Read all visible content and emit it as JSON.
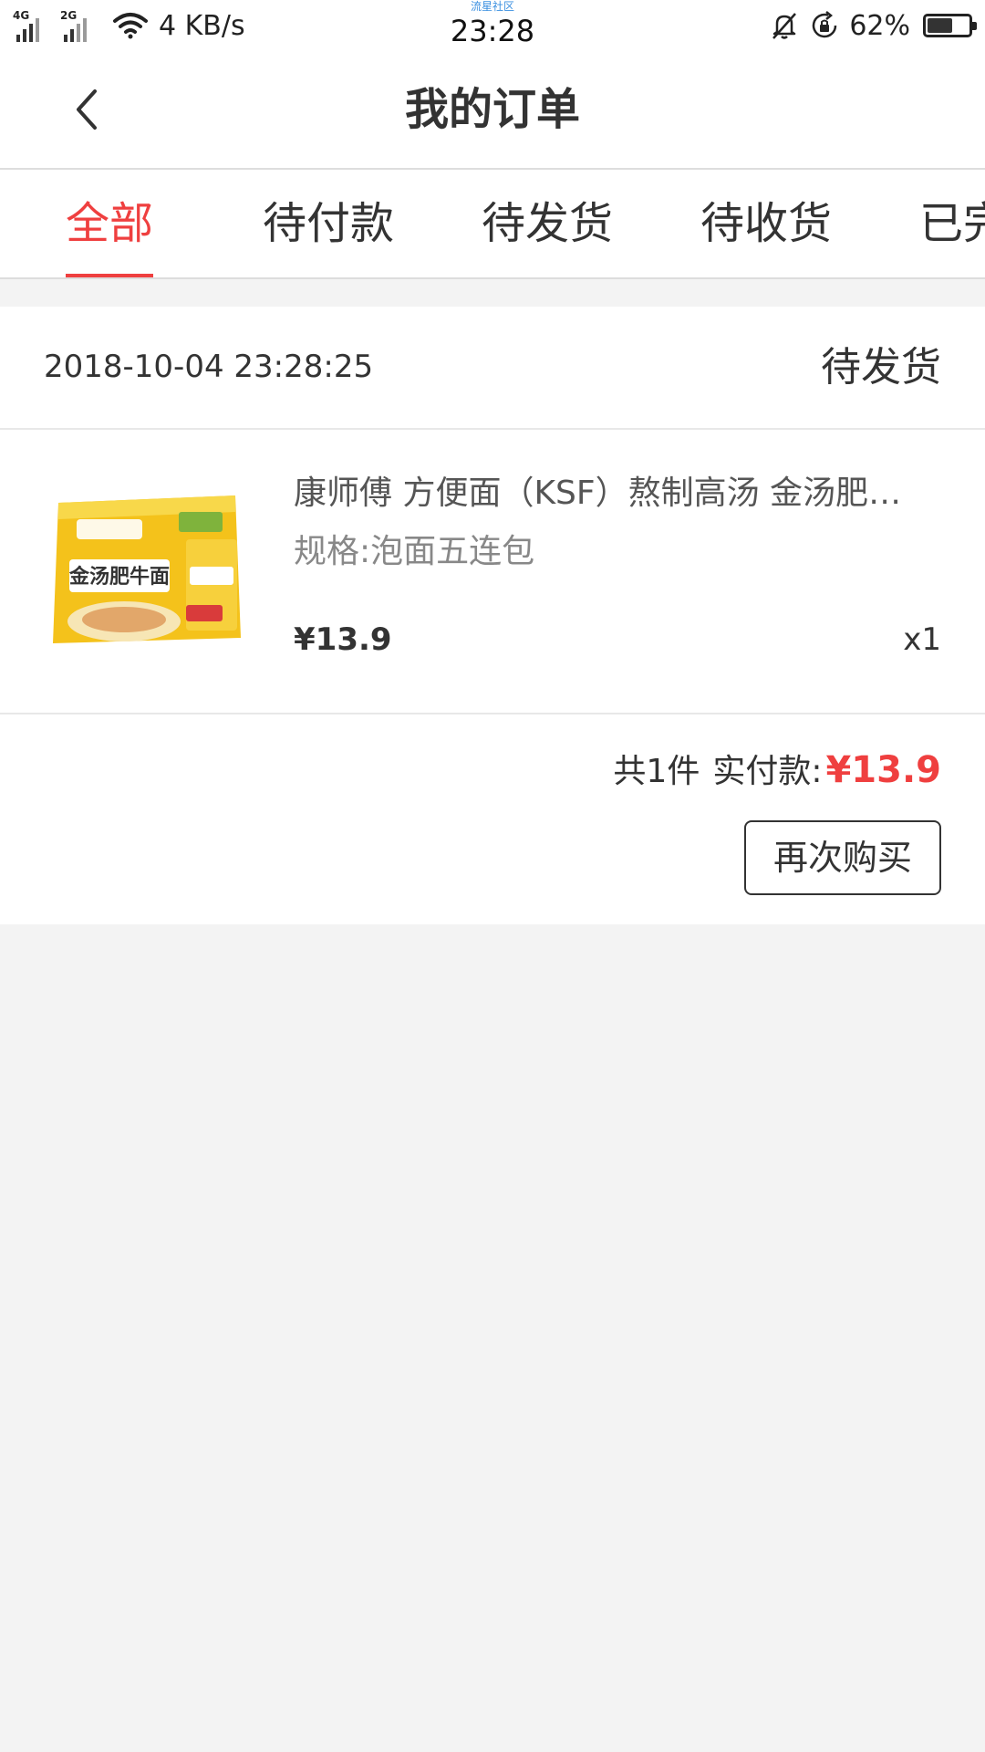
{
  "status_bar": {
    "network_1": "4G",
    "network_2": "2G",
    "speed": "4 KB/s",
    "carrier_tag": "流星社区",
    "time": "23:28",
    "battery_percent": "62%",
    "battery_level": 0.62,
    "icons": [
      "signal-icon",
      "wifi-icon",
      "mute-icon",
      "rotation-lock-icon",
      "battery-icon"
    ]
  },
  "nav": {
    "back_icon": "chevron-left-icon",
    "title": "我的订单"
  },
  "tabs": [
    {
      "label": "全部",
      "active": true
    },
    {
      "label": "待付款",
      "active": false
    },
    {
      "label": "待发货",
      "active": false
    },
    {
      "label": "待收货",
      "active": false
    },
    {
      "label": "已完成",
      "active": false
    }
  ],
  "order": {
    "time": "2018-10-04 23:28:25",
    "status": "待发货",
    "item": {
      "title": "康师傅 方便面（KSF）熬制高汤 金汤肥牛面",
      "spec": "规格:泡面五连包",
      "price": "¥13.9",
      "qty": "x1",
      "image_text": "金汤肥牛面"
    },
    "summary": {
      "count": "共1件",
      "paid_label": "实付款:",
      "paid_amount": "¥13.9"
    },
    "rebuy_label": "再次购买"
  },
  "colors": {
    "accent": "#ef3f3f",
    "background": "#f3f3f3",
    "text": "#333333"
  }
}
